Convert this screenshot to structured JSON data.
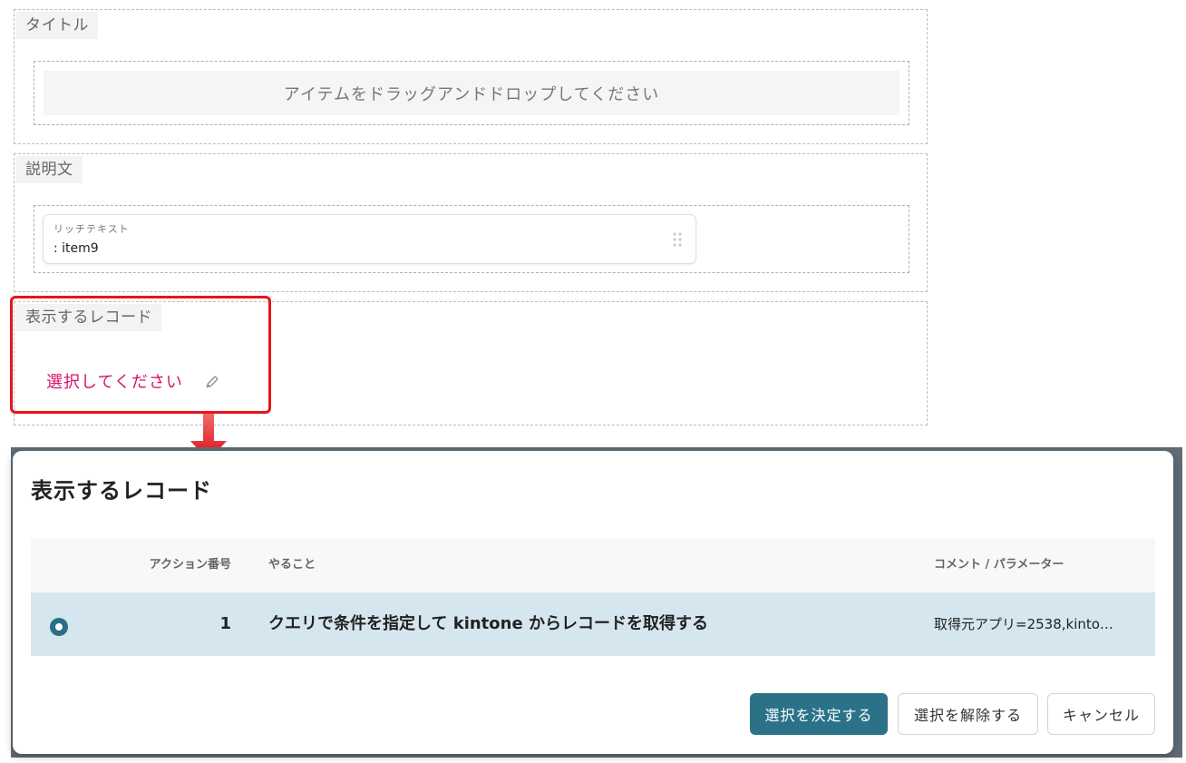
{
  "sections": {
    "title": {
      "label": "タイトル",
      "dropzone_text": "アイテムをドラッグアンドドロップしてください"
    },
    "description": {
      "label": "説明文",
      "item": {
        "type": "リッチテキスト",
        "name": ": item9"
      }
    },
    "records": {
      "label": "表示するレコード",
      "select_text": "選択してください"
    }
  },
  "modal": {
    "title": "表示するレコード",
    "table": {
      "headers": {
        "action_number": "アクション番号",
        "todo": "やること",
        "comment": "コメント / パラメーター"
      },
      "rows": [
        {
          "selected": true,
          "action_number": "1",
          "todo": "クエリで条件を指定して kintone からレコードを取得する",
          "comment": "取得元アプリ=2538,kinto…"
        }
      ]
    },
    "buttons": {
      "confirm": "選択を決定する",
      "clear": "選択を解除する",
      "cancel": "キャンセル"
    }
  },
  "colors": {
    "highlight_border": "#e8141c",
    "select_text": "#d6126b",
    "primary": "#2b7289",
    "selected_row": "#d6e6ee"
  }
}
